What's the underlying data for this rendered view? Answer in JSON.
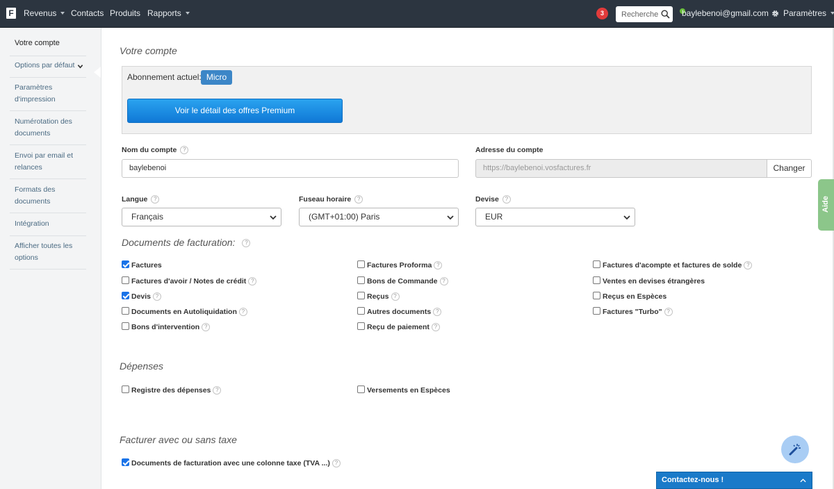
{
  "navbar": {
    "logo_letter": "F",
    "items": [
      {
        "label": "Revenus",
        "has_caret": true
      },
      {
        "label": "Contacts",
        "has_caret": false
      },
      {
        "label": "Produits",
        "has_caret": false
      },
      {
        "label": "Rapports",
        "has_caret": true
      }
    ],
    "notification_count": "3",
    "search_placeholder": "Rechercher",
    "user_email": "baylebenoi@gmail.com",
    "settings_label": "Paramètres"
  },
  "sidebar": {
    "items": [
      {
        "label": "Votre compte"
      },
      {
        "label": "Options par défaut"
      },
      {
        "label": "Paramètres d'impression"
      },
      {
        "label": "Numérotation des documents"
      },
      {
        "label": "Envoi par email et relances"
      },
      {
        "label": "Formats des documents"
      },
      {
        "label": "Intégration"
      },
      {
        "label": "Afficher toutes les options"
      }
    ]
  },
  "account": {
    "title": "Votre compte",
    "plan_label": "Abonnement actuel:",
    "plan_name": "Micro",
    "premium_button": "Voir le détail des offres Premium",
    "name_label": "Nom du compte",
    "name_value": "baylebenoi",
    "address_label": "Adresse du compte",
    "address_value": "https://baylebenoi.vosfactures.fr",
    "change_button": "Changer",
    "language_label": "Langue",
    "language_value": "Français",
    "timezone_label": "Fuseau horaire",
    "timezone_value": "(GMT+01:00) Paris",
    "currency_label": "Devise",
    "currency_value": "EUR"
  },
  "billing_docs": {
    "title": "Documents de facturation:",
    "options": [
      {
        "label": "Factures",
        "checked": true,
        "help": false
      },
      {
        "label": "Factures Proforma",
        "checked": false,
        "help": true
      },
      {
        "label": "Factures d'acompte et factures de solde",
        "checked": false,
        "help": true
      },
      {
        "label": "Factures d'avoir / Notes de crédit",
        "checked": false,
        "help": true
      },
      {
        "label": "Bons de Commande",
        "checked": false,
        "help": true
      },
      {
        "label": "Ventes en devises étrangères",
        "checked": false,
        "help": false
      },
      {
        "label": "Devis",
        "checked": true,
        "help": true
      },
      {
        "label": "Reçus",
        "checked": false,
        "help": true
      },
      {
        "label": "Reçus en Espèces",
        "checked": false,
        "help": false
      },
      {
        "label": "Documents en Autoliquidation",
        "checked": false,
        "help": true
      },
      {
        "label": "Autres documents",
        "checked": false,
        "help": true
      },
      {
        "label": "Factures \"Turbo\"",
        "checked": false,
        "help": true
      },
      {
        "label": "Bons d'intervention",
        "checked": false,
        "help": true
      },
      {
        "label": "Reçu de paiement",
        "checked": false,
        "help": true
      }
    ]
  },
  "expenses": {
    "title": "Dépenses",
    "options": [
      {
        "label": "Registre des dépenses",
        "checked": false,
        "help": true
      },
      {
        "label": "Versements en Espèces",
        "checked": false,
        "help": false
      }
    ]
  },
  "tax": {
    "title": "Facturer avec ou sans taxe",
    "options": [
      {
        "label": "Documents de facturation avec une colonne taxe (TVA ...)",
        "checked": true,
        "help": true
      }
    ]
  },
  "widgets": {
    "help_tab": "Aide",
    "contact_label": "Contactez-nous !",
    "help_glyph": "?"
  },
  "colors": {
    "navbar_bg": "#2c3540",
    "primary_blue": "#1a7ac9",
    "badge_red": "#e23b3b",
    "help_green": "#8cc68a"
  }
}
